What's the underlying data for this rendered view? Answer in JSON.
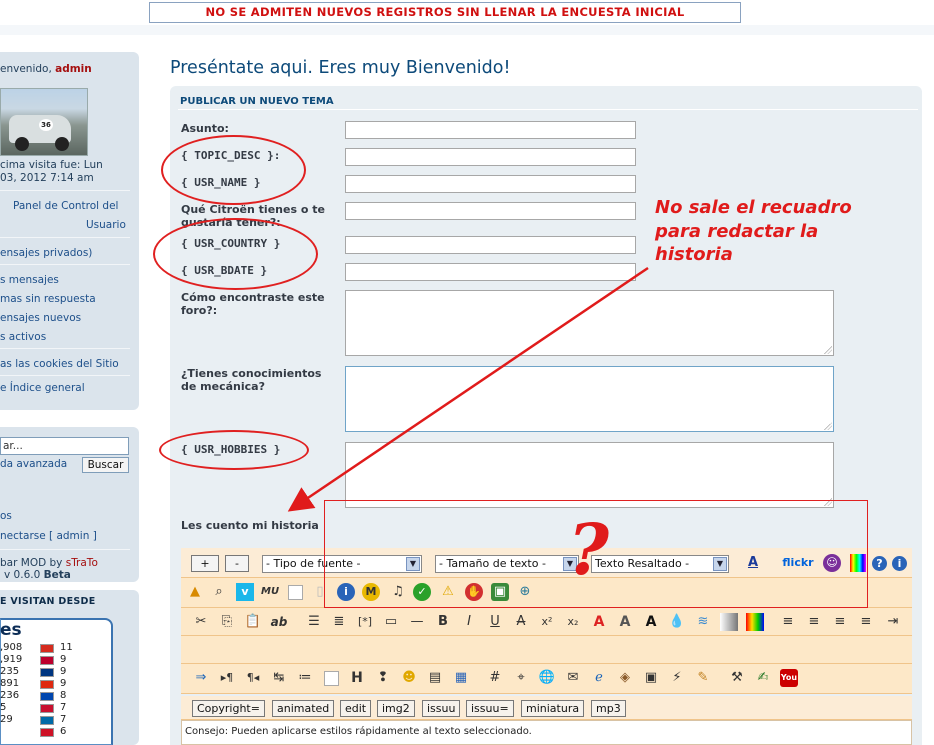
{
  "banner": "NO SE ADMITEN NUEVOS REGISTROS SIN LLENAR LA ENCUESTA INICIAL",
  "sidebar": {
    "welcome_prefix": "envenido, ",
    "username": "admin",
    "last_visit_1": "cima visita fue: Lun",
    "last_visit_2": "03, 2012 7:14 am",
    "panel_control_1": "Panel de Control del",
    "panel_control_2": "Usuario",
    "private_msgs": "ensajes privados)",
    "links": [
      "s mensajes",
      "mas sin respuesta",
      "ensajes nuevos",
      "s activos"
    ],
    "cookies": "as las cookies del Sitio",
    "index": "e Índice general",
    "search_placeholder": "ar...",
    "advanced_search": "da avanzada",
    "search_button": "Buscar",
    "misc1": "os",
    "logout": "nectarse [ admin ]",
    "mod_credit_1": "bar MOD by ",
    "mod_author": "sTraTo",
    "mod_credit_2": "v 0.6.0 ",
    "mod_beta": "Beta",
    "visitors_title": "E VISITAN DESDE",
    "flags_title": "es",
    "flag_rows": [
      {
        "left": ",908",
        "right": "11",
        "color": "#d52b1e"
      },
      {
        "left": ",919",
        "right": "9",
        "color": "#bc002d"
      },
      {
        "left": "235",
        "right": "9",
        "color": "#003580"
      },
      {
        "left": "891",
        "right": "9",
        "color": "#de2910"
      },
      {
        "left": "236",
        "right": "8",
        "color": "#0046ae"
      },
      {
        "left": "5",
        "right": "7",
        "color": "#c8102e"
      },
      {
        "left": "29",
        "right": "7",
        "color": "#006aa7"
      },
      {
        "left": "",
        "right": "6",
        "color": "#ce1126"
      }
    ]
  },
  "page_title": "Preséntate aqui. Eres muy Bienvenido!",
  "form": {
    "header": "PUBLICAR UN NUEVO TEMA",
    "subject_label": "Asunto:",
    "topic_desc_label": "{ TOPIC_DESC }:",
    "usr_name_label": "{ USR_NAME }",
    "citroen_label_1": "Qué Citroën tienes o te",
    "citroen_label_2": "gustaría tener?:",
    "usr_country_label": "{ USR_COUNTRY }",
    "usr_bdate_label": "{ USR_BDATE }",
    "found_label_1": "Cómo encontraste este",
    "found_label_2": "foro?:",
    "mech_label_1": "¿Tienes conocimientos",
    "mech_label_2": "de mecánica?",
    "usr_hobbies_label": "{ USR_HOBBIES }",
    "story_label": "Les cuento mi historia"
  },
  "annotation": {
    "line1": "No sale el recuadro",
    "line2": "para redactar la",
    "line3": "historia",
    "qmark": "?"
  },
  "editor": {
    "plus": "+",
    "minus": "-",
    "font_type": "- Tipo de fuente -",
    "font_size": "- Tamaño de texto -",
    "highlight": "Texto Resaltado -",
    "flickr": "flickr",
    "tag_buttons": [
      "Copyright=",
      "animated",
      "edit",
      "img2",
      "issuu",
      "issuu=",
      "miniatura",
      "mp3"
    ],
    "tip": "Consejo: Pueden aplicarse estilos rápidamente al texto seleccionado."
  },
  "colors": {
    "accent_red": "#e01b1b",
    "title_blue": "#0d4a7a",
    "editor_bg": "#fde8c8"
  }
}
